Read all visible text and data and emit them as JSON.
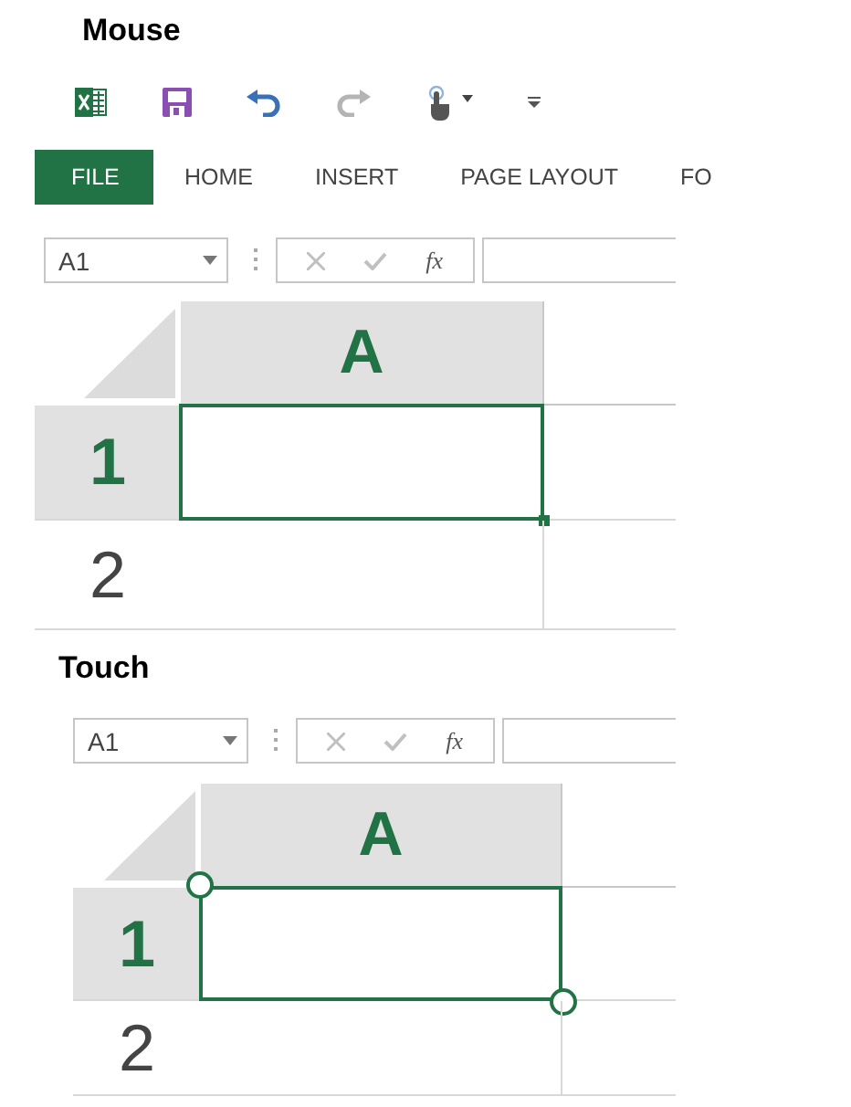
{
  "sections": [
    {
      "title": "Mouse",
      "kind": "mouse",
      "quick_access": [
        {
          "kind": "app",
          "disabled": false
        },
        {
          "kind": "save",
          "disabled": false
        },
        {
          "kind": "undo",
          "disabled": false
        },
        {
          "kind": "redo",
          "disabled": true
        },
        {
          "kind": "touch_mode",
          "disabled": false
        },
        {
          "kind": "customize",
          "disabled": false
        }
      ],
      "ribbon_tabs": [
        {
          "label": "FILE",
          "selected": true
        },
        {
          "label": "HOME",
          "selected": false
        },
        {
          "label": "INSERT",
          "selected": false
        },
        {
          "label": "PAGE LAYOUT",
          "selected": false
        },
        {
          "label": "FO",
          "selected": false
        }
      ],
      "name_box": {
        "value": "A1"
      },
      "function_label": "fx",
      "columns": [
        {
          "label": "A",
          "selected": true
        }
      ],
      "rows": [
        {
          "label": "1",
          "selected": true
        },
        {
          "label": "2",
          "selected": false
        }
      ]
    },
    {
      "title": "Touch",
      "kind": "touch",
      "name_box": {
        "value": "A1"
      },
      "function_label": "fx",
      "columns": [
        {
          "label": "A",
          "selected": true
        }
      ],
      "rows": [
        {
          "label": "1",
          "selected": true
        },
        {
          "label": "2",
          "selected": false
        }
      ]
    }
  ]
}
